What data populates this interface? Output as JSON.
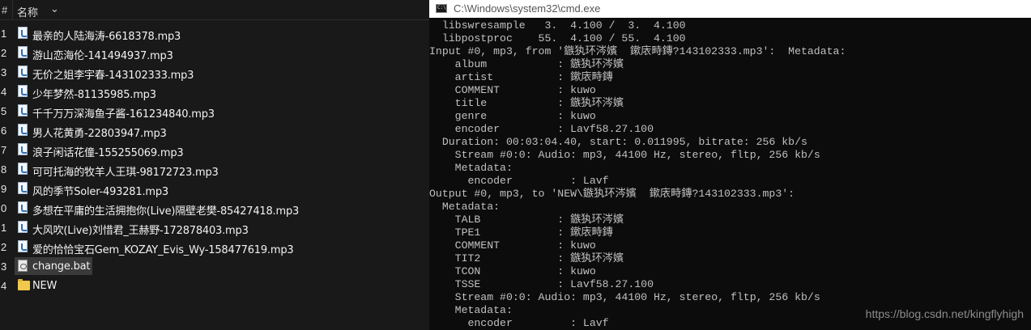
{
  "explorer": {
    "header_index": "#",
    "header_name": "名称",
    "header_chevron": "⌄",
    "files": [
      {
        "index": "1",
        "name": "最亲的人陆海涛-6618378.mp3",
        "type": "mp3"
      },
      {
        "index": "2",
        "name": "游山恋海伦-141494937.mp3",
        "type": "mp3"
      },
      {
        "index": "3",
        "name": "无价之姐李宇春-143102333.mp3",
        "type": "mp3"
      },
      {
        "index": "4",
        "name": "少年梦然-81135985.mp3",
        "type": "mp3"
      },
      {
        "index": "5",
        "name": "千千万万深海鱼子酱-161234840.mp3",
        "type": "mp3"
      },
      {
        "index": "6",
        "name": "男人花黄勇-22803947.mp3",
        "type": "mp3"
      },
      {
        "index": "7",
        "name": "浪子闲话花僮-155255069.mp3",
        "type": "mp3"
      },
      {
        "index": "8",
        "name": "可可托海的牧羊人王琪-98172723.mp3",
        "type": "mp3"
      },
      {
        "index": "9",
        "name": "风的季节Soler-493281.mp3",
        "type": "mp3"
      },
      {
        "index": "0",
        "name": "多想在平庸的生活拥抱你(Live)隔壁老樊-85427418.mp3",
        "type": "mp3"
      },
      {
        "index": "1",
        "name": "大风吹(Live)刘惜君_王赫野-172878403.mp3",
        "type": "mp3"
      },
      {
        "index": "2",
        "name": "爱的恰恰宝石Gem_KOZAY_Evis_Wy-158477619.mp3",
        "type": "mp3"
      },
      {
        "index": "3",
        "name": "change.bat",
        "type": "bat",
        "selected": true
      },
      {
        "index": "4",
        "name": "NEW",
        "type": "folder"
      }
    ]
  },
  "cmd": {
    "title": "C:\\Windows\\system32\\cmd.exe",
    "lines": [
      "  libswresample   3.  4.100 /  3.  4.100",
      "  libpostproc    55.  4.100 / 55.  4.100",
      "Input #0, mp3, from '鏃犱环涔嬪  鏉庡畤鏄?143102333.mp3':  Metadata:",
      "    album           : 鏃犱环涔嬪",
      "    artist          : 鏉庡畤鏄",
      "    COMMENT         : kuwo",
      "    title           : 鏃犱环涔嬪",
      "    genre           : kuwo",
      "    encoder         : Lavf58.27.100",
      "  Duration: 00:03:04.40, start: 0.011995, bitrate: 256 kb/s",
      "    Stream #0:0: Audio: mp3, 44100 Hz, stereo, fltp, 256 kb/s",
      "    Metadata:",
      "      encoder         : Lavf",
      "Output #0, mp3, to 'NEW\\鏃犱环涔嬪  鏉庡畤鏄?143102333.mp3':",
      "  Metadata:",
      "    TALB            : 鏃犱环涔嬪",
      "    TPE1            : 鏉庡畤鏄",
      "    COMMENT         : kuwo",
      "    TIT2            : 鏃犱环涔嬪",
      "    TCON            : kuwo",
      "    TSSE            : Lavf58.27.100",
      "    Stream #0:0: Audio: mp3, 44100 Hz, stereo, fltp, 256 kb/s",
      "    Metadata:",
      "      encoder         : Lavf"
    ]
  },
  "watermark": "https://blog.csdn.net/kingflyhigh"
}
